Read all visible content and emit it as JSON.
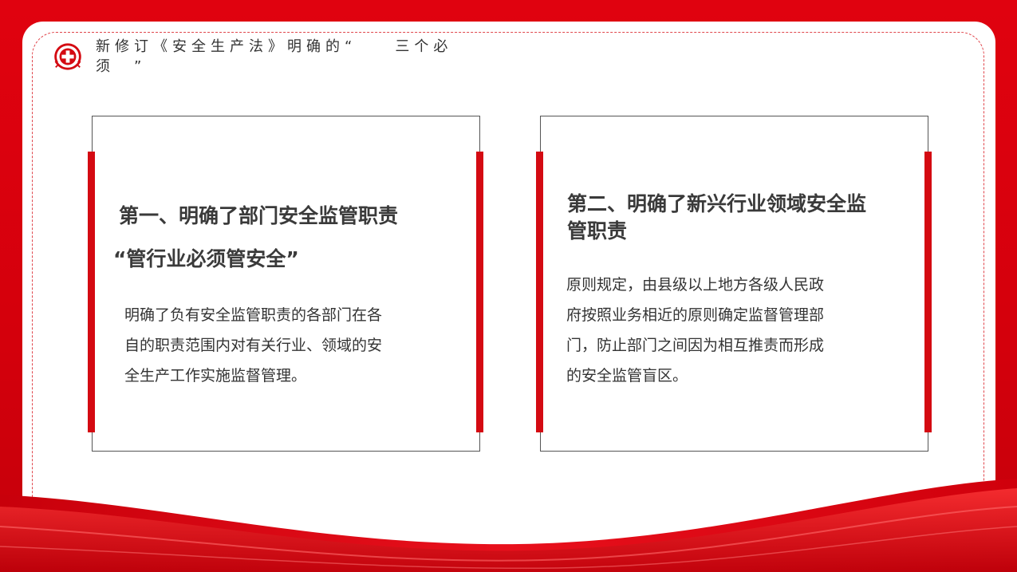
{
  "header": {
    "title": "新修订《安全生产法》明确的“　　三个必须　”"
  },
  "cards": [
    {
      "heading_line1": "第一、明确了部门安全监管职责",
      "heading_line2": "“管行业必须管安全”",
      "body_lines": [
        "明确了负有安全监管职责的各部门在各",
        "自的职责范围内对有关行业、领域的安",
        "全生产工作实施监督管理。"
      ]
    },
    {
      "heading_line1": "第二、明确了新兴行业领域安全监",
      "heading_line2": "管职责",
      "body_lines": [
        "原则规定，由县级以上地方各级人民政",
        "府按照业务相近的原则确定监督管理部",
        "门，防止部门之间因为相互推责而形成",
        "的安全监管盲区。"
      ]
    }
  ],
  "colors": {
    "brand_red": "#d40a12",
    "background_red": "#e30613"
  },
  "icons": {
    "logo": "safety-cross-emblem-icon"
  }
}
